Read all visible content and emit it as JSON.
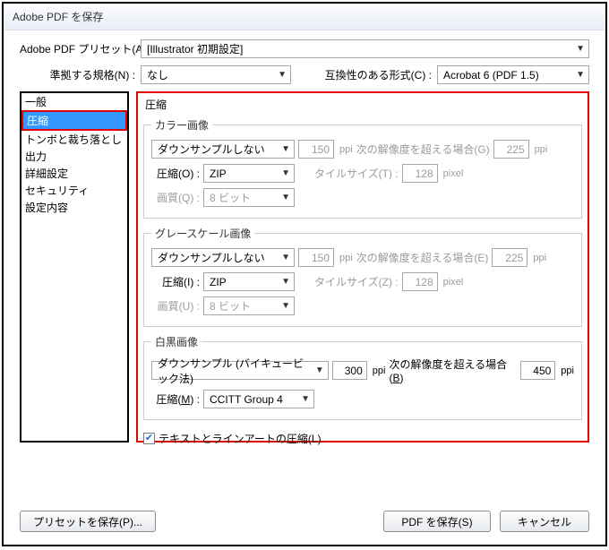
{
  "window": {
    "title": "Adobe PDF を保存"
  },
  "preset": {
    "label": "Adobe PDF プリセット(A) :",
    "value": "[Illustrator 初期設定]"
  },
  "standard": {
    "label": "準拠する規格(N) :",
    "value": "なし"
  },
  "compat": {
    "label": "互換性のある形式(C) :",
    "value": "Acrobat 6 (PDF 1.5)"
  },
  "sidebar": {
    "items": [
      "一般",
      "圧縮",
      "トンボと裁ち落とし",
      "出力",
      "詳細設定",
      "セキュリティ",
      "設定内容"
    ]
  },
  "panel": {
    "title": "圧縮",
    "color": {
      "legend": "カラー画像",
      "downsample": "ダウンサンプルしない",
      "ppi1": "150",
      "ppi_unit": "ppi",
      "over_label": "次の解像度を超える場合(G)",
      "ppi2": "225",
      "compress_label": "圧縮(O) :",
      "compress_value": "ZIP",
      "tile_label": "タイルサイズ(T) :",
      "tile_value": "128",
      "tile_unit": "pixel",
      "quality_label": "画質(Q) :",
      "quality_value": "8 ビット"
    },
    "gray": {
      "legend": "グレースケール画像",
      "downsample": "ダウンサンプルしない",
      "ppi1": "150",
      "ppi_unit": "ppi",
      "over_label": "次の解像度を超える場合(E)",
      "ppi2": "225",
      "compress_label": "圧縮(I) :",
      "compress_value": "ZIP",
      "tile_label": "タイルサイズ(Z) :",
      "tile_value": "128",
      "tile_unit": "pixel",
      "quality_label": "画質(U) :",
      "quality_value": "8 ビット"
    },
    "mono": {
      "legend": "白黒画像",
      "downsample": "ダウンサンプル (バイキュービック法)",
      "ppi1": "300",
      "ppi_unit": "ppi",
      "over_label": "次の解像度を超える場合(",
      "over_accel": "B",
      "over_close": ")",
      "ppi2": "450",
      "compress_label_pre": "圧縮(",
      "compress_accel": "M",
      "compress_label_post": ") :",
      "compress_value": "CCITT Group 4"
    },
    "text_art": "テキストとラインアートの圧縮(L)"
  },
  "footer": {
    "save_preset": "プリセットを保存(P)...",
    "save_pdf": "PDF を保存(S)",
    "cancel": "キャンセル"
  }
}
